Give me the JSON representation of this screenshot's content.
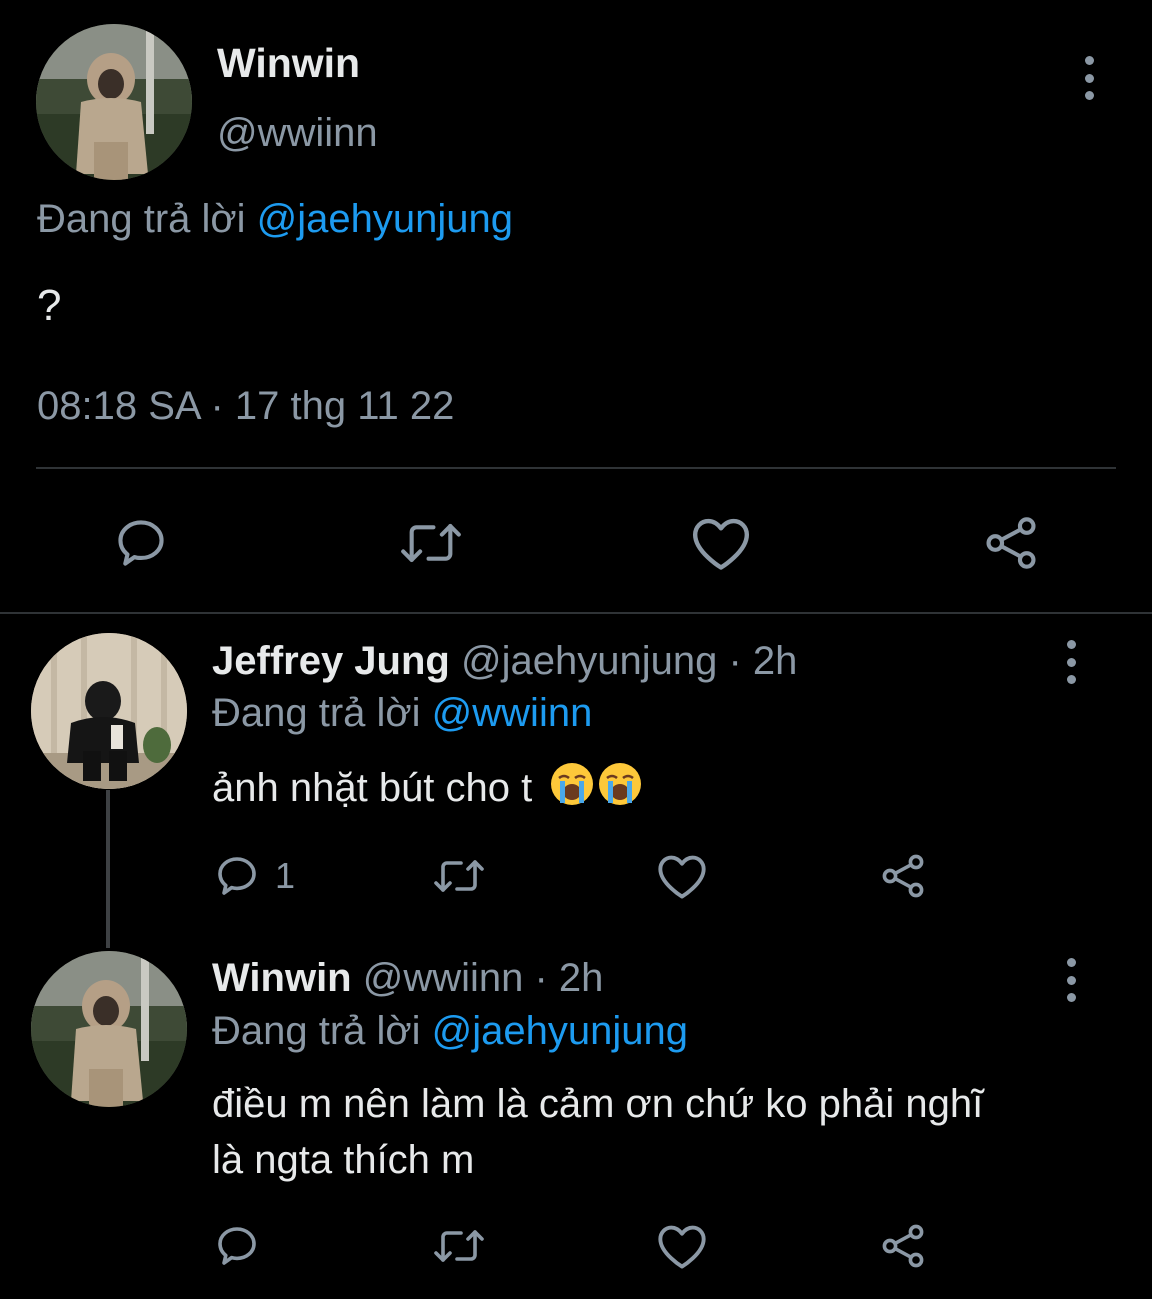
{
  "main_tweet": {
    "display_name": "Winwin",
    "handle": "@wwiinn",
    "reply_prefix": "Đang trả lời",
    "reply_to": "@jaehyunjung",
    "text": "?",
    "timestamp": "08:18 SA · 17 thg 11 22"
  },
  "replies": [
    {
      "display_name": "Jeffrey Jung",
      "meta": "@jaehyunjung · 2h",
      "reply_prefix": "Đang trả lời",
      "reply_to": "@wwiinn",
      "text": "ảnh nhặt bút cho t",
      "emojis": [
        "loudly-crying-face",
        "loudly-crying-face"
      ],
      "reply_count": "1"
    },
    {
      "display_name": "Winwin",
      "meta": "@wwiinn · 2h",
      "reply_prefix": "Đang trả lời",
      "reply_to": "@jaehyunjung",
      "text": "điều m nên làm là cảm ơn chứ ko phải nghĩ là ngta thích m",
      "reply_count": ""
    }
  ],
  "icons": [
    "more-vertical-icon",
    "reply-icon",
    "retweet-icon",
    "like-icon",
    "share-icon"
  ],
  "colors": {
    "background": "#000000",
    "text_primary": "#e7e9ea",
    "text_secondary": "#8b98a5",
    "accent": "#1d9bf0",
    "divider": "#2f3336"
  }
}
